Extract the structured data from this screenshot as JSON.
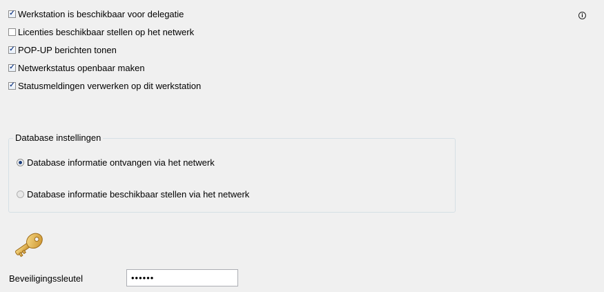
{
  "options": [
    {
      "label": "Werkstation is beschikbaar voor delegatie",
      "checked": true
    },
    {
      "label": "Licenties beschikbaar stellen op het netwerk",
      "checked": false
    },
    {
      "label": "POP-UP berichten tonen",
      "checked": true
    },
    {
      "label": "Netwerkstatus openbaar maken",
      "checked": true
    },
    {
      "label": "Statusmeldingen verwerken op dit werkstation",
      "checked": true
    }
  ],
  "info_icon": "info-circle-icon",
  "database": {
    "title": "Database instellingen",
    "options": [
      {
        "label": "Database informatie ontvangen via het netwerk",
        "selected": true
      },
      {
        "label": "Database informatie beschikbaar stellen via het netwerk",
        "selected": false
      }
    ]
  },
  "security": {
    "icon": "key-icon",
    "label": "Beveiligingssleutel",
    "value": "••••••"
  },
  "colors": {
    "background": "#f0f0f0",
    "check": "#21458c",
    "key": "#e2b04a"
  }
}
